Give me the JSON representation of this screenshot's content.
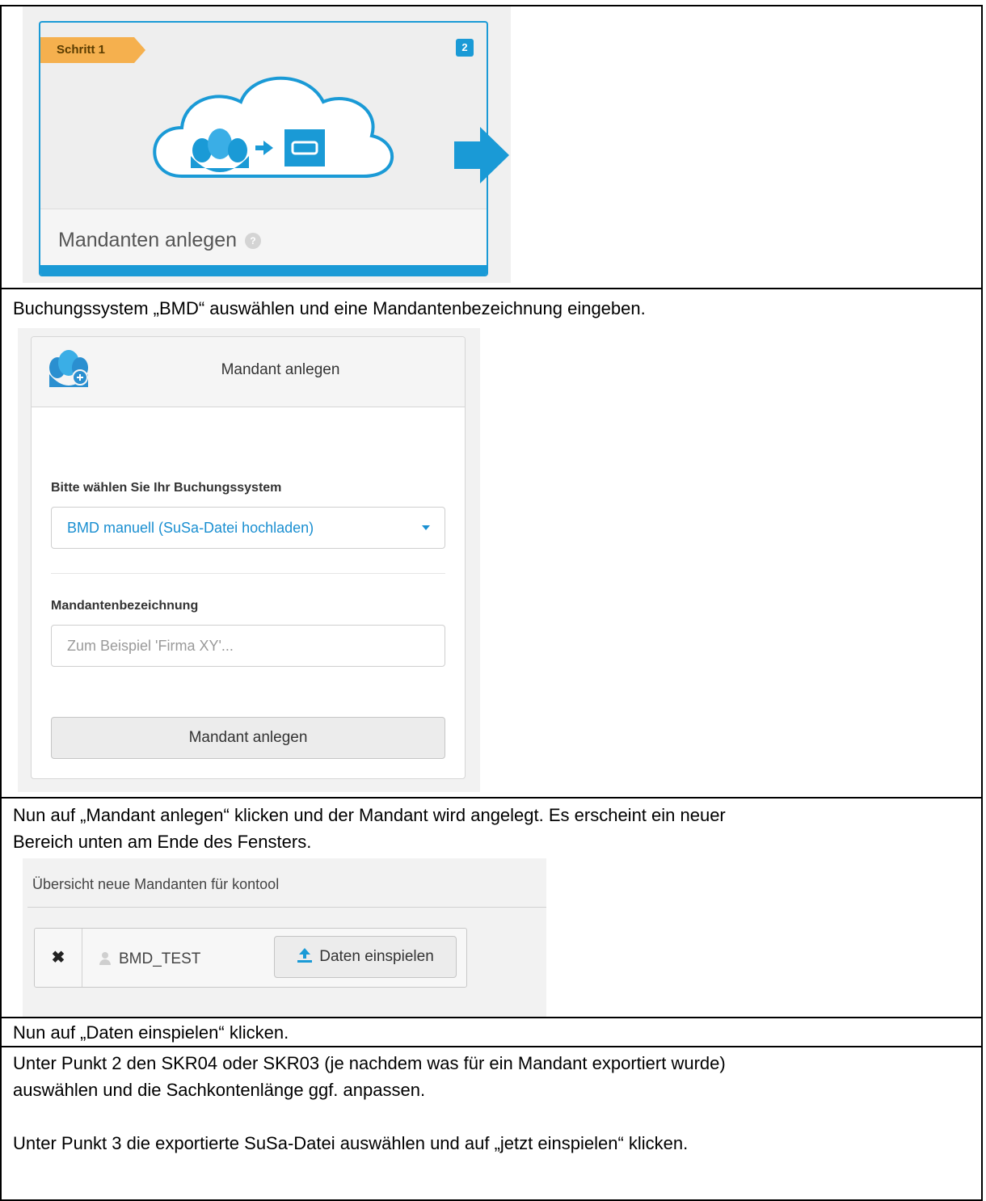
{
  "step": {
    "ribbon": "Schritt 1",
    "badge": "2",
    "title": "Mandanten anlegen",
    "help": "?"
  },
  "instruction_1": "Buchungssystem „BMD“ auswählen und eine Mandantenbezeichnung eingeben.",
  "form": {
    "header_title": "Mandant anlegen",
    "booking_label": "Bitte wählen Sie Ihr Buchungssystem",
    "booking_value": "BMD manuell (SuSa-Datei hochladen)",
    "name_label": "Mandantenbezeichnung",
    "name_placeholder": "Zum Beispiel 'Firma XY'...",
    "submit_label": "Mandant anlegen"
  },
  "instruction_2_line1": "Nun auf „Mandant anlegen“ klicken und der Mandant wird angelegt. Es erscheint ein neuer",
  "instruction_2_line2": "Bereich unten am Ende des Fensters.",
  "overview": {
    "title": "Übersicht neue Mandanten für kontool",
    "remove": "✖",
    "client_name": "BMD_TEST",
    "import_label": "Daten einspielen"
  },
  "instruction_3": "Nun auf „Daten einspielen“ klicken.",
  "instruction_4_line1": "Unter Punkt 2 den SKR04 oder SKR03 (je nachdem was für ein Mandant exportiert wurde)",
  "instruction_4_line2": "auswählen und die Sachkontenlänge ggf. anpassen.",
  "instruction_5": "Unter Punkt 3 die exportierte SuSa-Datei auswählen und auf „jetzt einspielen“ klicken.",
  "colors": {
    "accent": "#1a9ad6",
    "ribbon": "#f5b04e"
  },
  "icons": [
    "clients-cloud-icon",
    "arrow-right-icon",
    "client-add-icon",
    "close-icon",
    "user-icon",
    "upload-icon"
  ]
}
